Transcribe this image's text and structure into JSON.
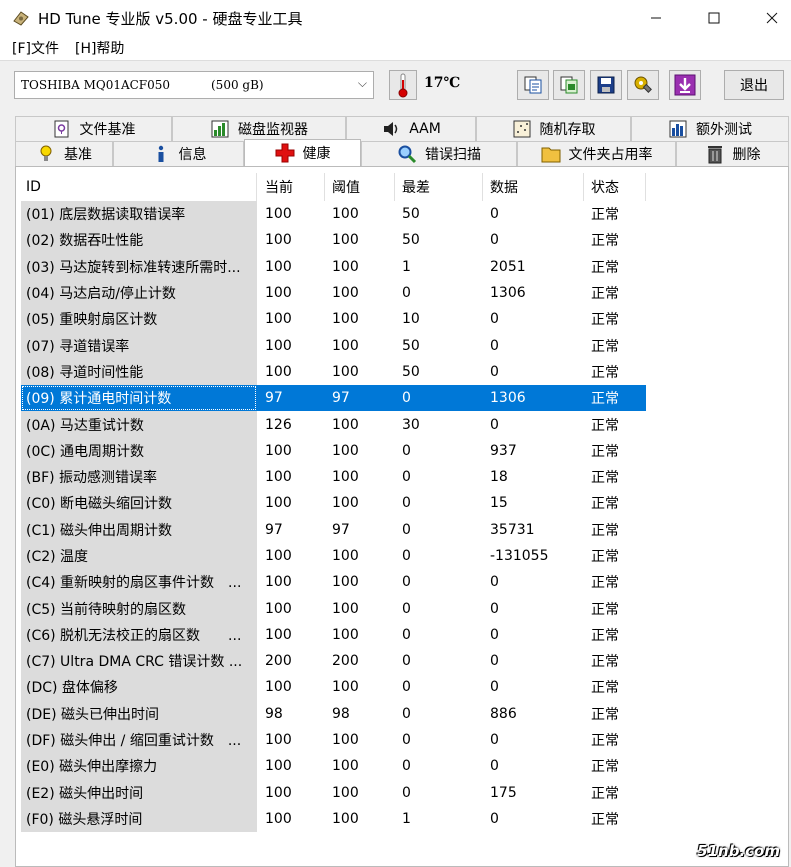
{
  "window": {
    "title": "HD Tune 专业版 v5.00 - 硬盘专业工具"
  },
  "menu": {
    "file": "[F]文件",
    "help": "[H]帮助"
  },
  "toolbar": {
    "drive_name": "TOSHIBA MQ01ACF050",
    "drive_size": "(500 gB)",
    "temperature": "17℃",
    "exit_label": "退出"
  },
  "tabs_top": [
    {
      "label": "文件基准",
      "icon": "file-benchmark-icon"
    },
    {
      "label": "磁盘监视器",
      "icon": "disk-monitor-icon"
    },
    {
      "label": "AAM",
      "icon": "speaker-icon"
    },
    {
      "label": "随机存取",
      "icon": "random-access-icon"
    },
    {
      "label": "额外测试",
      "icon": "extra-tests-icon"
    }
  ],
  "tabs_bottom": [
    {
      "label": "基准",
      "icon": "benchmark-icon"
    },
    {
      "label": "信息",
      "icon": "info-icon"
    },
    {
      "label": "健康",
      "icon": "health-cross-icon"
    },
    {
      "label": "错误扫描",
      "icon": "magnifier-icon"
    },
    {
      "label": "文件夹占用率",
      "icon": "folder-icon"
    },
    {
      "label": "删除",
      "icon": "trash-icon"
    }
  ],
  "table": {
    "headers": {
      "id": "ID",
      "current": "当前",
      "threshold": "阈值",
      "worst": "最差",
      "data": "数据",
      "status": "状态"
    },
    "rows": [
      {
        "id": "(01) 底层数据读取错误率",
        "current": "100",
        "threshold": "100",
        "worst": "50",
        "data": "0",
        "status": "正常"
      },
      {
        "id": "(02) 数据吞吐性能",
        "current": "100",
        "threshold": "100",
        "worst": "50",
        "data": "0",
        "status": "正常"
      },
      {
        "id": "(03) 马达旋转到标准转速所需时...",
        "current": "100",
        "threshold": "100",
        "worst": "1",
        "data": "2051",
        "status": "正常"
      },
      {
        "id": "(04) 马达启动/停止计数",
        "current": "100",
        "threshold": "100",
        "worst": "0",
        "data": "1306",
        "status": "正常"
      },
      {
        "id": "(05) 重映射扇区计数",
        "current": "100",
        "threshold": "100",
        "worst": "10",
        "data": "0",
        "status": "正常"
      },
      {
        "id": "(07) 寻道错误率",
        "current": "100",
        "threshold": "100",
        "worst": "50",
        "data": "0",
        "status": "正常"
      },
      {
        "id": "(08) 寻道时间性能",
        "current": "100",
        "threshold": "100",
        "worst": "50",
        "data": "0",
        "status": "正常"
      },
      {
        "id": "(09) 累计通电时间计数",
        "current": "97",
        "threshold": "97",
        "worst": "0",
        "data": "1306",
        "status": "正常",
        "selected": true
      },
      {
        "id": "(0A) 马达重试计数",
        "current": "126",
        "threshold": "100",
        "worst": "30",
        "data": "0",
        "status": "正常"
      },
      {
        "id": "(0C) 通电周期计数",
        "current": "100",
        "threshold": "100",
        "worst": "0",
        "data": "937",
        "status": "正常"
      },
      {
        "id": "(BF) 振动感测错误率",
        "current": "100",
        "threshold": "100",
        "worst": "0",
        "data": "18",
        "status": "正常"
      },
      {
        "id": "(C0) 断电磁头缩回计数",
        "current": "100",
        "threshold": "100",
        "worst": "0",
        "data": "15",
        "status": "正常"
      },
      {
        "id": "(C1) 磁头伸出周期计数",
        "current": "97",
        "threshold": "97",
        "worst": "0",
        "data": "35731",
        "status": "正常"
      },
      {
        "id": "(C2) 温度",
        "current": "100",
        "threshold": "100",
        "worst": "0",
        "data": "-131055",
        "status": "正常"
      },
      {
        "id": "(C4) 重新映射的扇区事件计数　...",
        "current": "100",
        "threshold": "100",
        "worst": "0",
        "data": "0",
        "status": "正常"
      },
      {
        "id": "(C5) 当前待映射的扇区数",
        "current": "100",
        "threshold": "100",
        "worst": "0",
        "data": "0",
        "status": "正常"
      },
      {
        "id": "(C6) 脱机无法校正的扇区数　　...",
        "current": "100",
        "threshold": "100",
        "worst": "0",
        "data": "0",
        "status": "正常"
      },
      {
        "id": "(C7) Ultra DMA CRC 错误计数 ...",
        "current": "200",
        "threshold": "200",
        "worst": "0",
        "data": "0",
        "status": "正常"
      },
      {
        "id": "(DC) 盘体偏移",
        "current": "100",
        "threshold": "100",
        "worst": "0",
        "data": "0",
        "status": "正常"
      },
      {
        "id": "(DE) 磁头已伸出时间",
        "current": "98",
        "threshold": "98",
        "worst": "0",
        "data": "886",
        "status": "正常"
      },
      {
        "id": "(DF) 磁头伸出 / 缩回重试计数　...",
        "current": "100",
        "threshold": "100",
        "worst": "0",
        "data": "0",
        "status": "正常"
      },
      {
        "id": "(E0) 磁头伸出摩擦力",
        "current": "100",
        "threshold": "100",
        "worst": "0",
        "data": "0",
        "status": "正常"
      },
      {
        "id": "(E2) 磁头伸出时间",
        "current": "100",
        "threshold": "100",
        "worst": "0",
        "data": "175",
        "status": "正常"
      },
      {
        "id": "(F0) 磁头悬浮时间",
        "current": "100",
        "threshold": "100",
        "worst": "1",
        "data": "0",
        "status": "正常"
      }
    ]
  },
  "watermark": "51nb.com"
}
